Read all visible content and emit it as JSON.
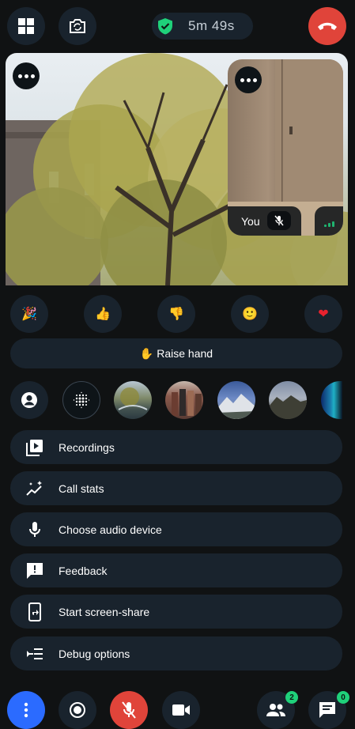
{
  "header": {
    "timer": "5m 49s"
  },
  "self_view": {
    "name": "You"
  },
  "reactions": [
    {
      "icon": "party-popper-icon",
      "glyph": "🎉"
    },
    {
      "icon": "thumbs-up-icon",
      "glyph": "👍"
    },
    {
      "icon": "thumbs-down-icon",
      "glyph": "👎"
    },
    {
      "icon": "smile-icon",
      "glyph": "🙂"
    },
    {
      "icon": "heart-icon",
      "glyph": "❤"
    }
  ],
  "raise_hand": {
    "label": "✋ Raise hand"
  },
  "menu": {
    "recordings": "Recordings",
    "call_stats": "Call stats",
    "audio_device": "Choose audio device",
    "feedback": "Feedback",
    "screen_share": "Start screen-share",
    "debug": "Debug options"
  },
  "badges": {
    "participants": "2",
    "chat": "0"
  },
  "colors": {
    "panel": "#19232d",
    "background": "#101213",
    "hangup_red": "#e0443a",
    "accent_blue": "#2b6bff",
    "success_green": "#1fd17a"
  }
}
